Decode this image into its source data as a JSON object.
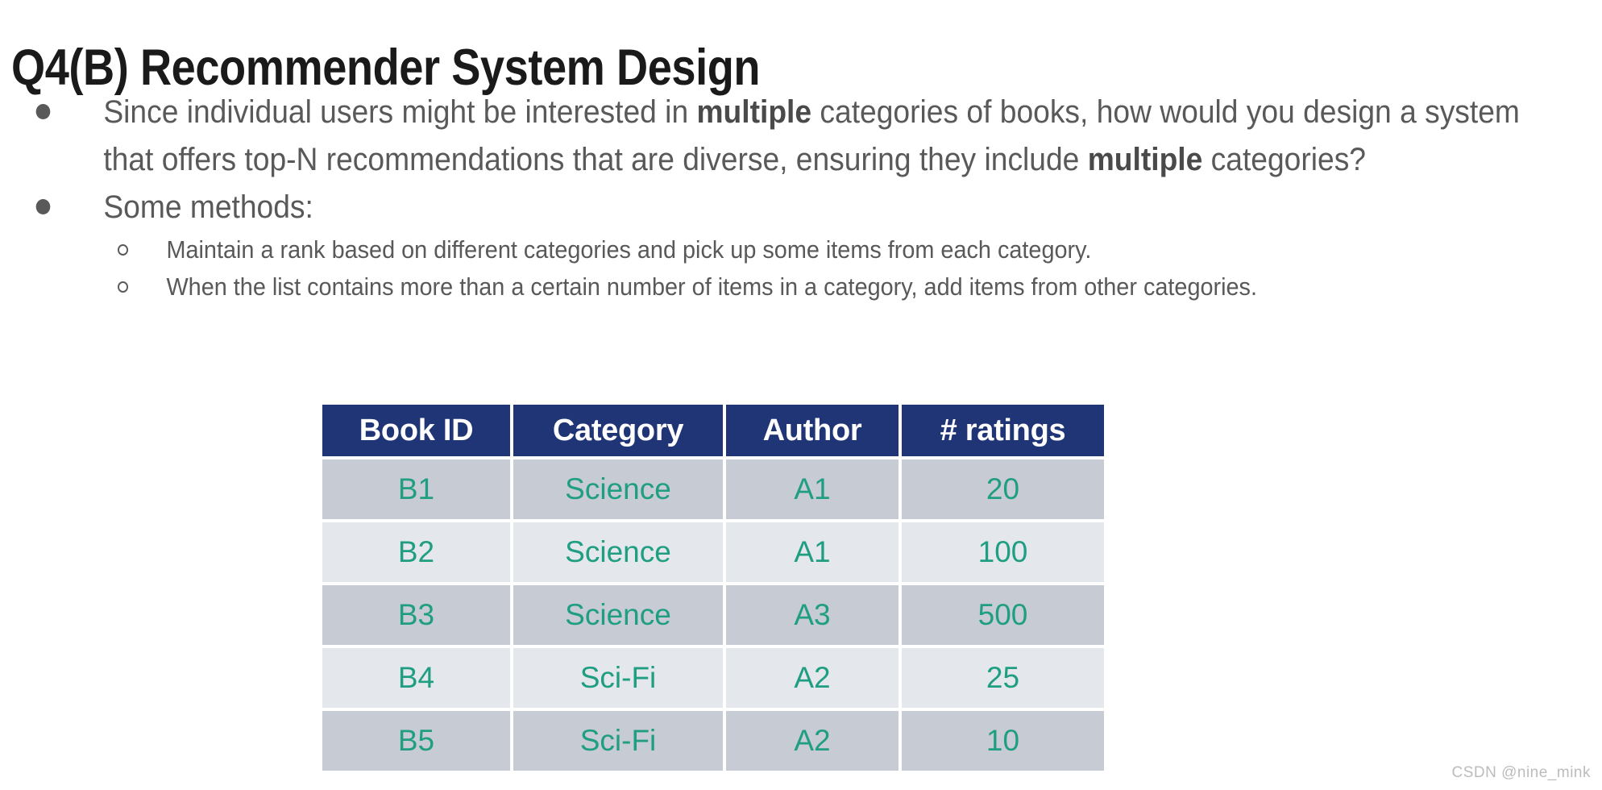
{
  "slide": {
    "title": "Q4(B) Recommender System Design",
    "bullets": [
      {
        "level": 1,
        "marker": "filled-disc",
        "segments": [
          {
            "text": "Since individual users might be interested in ",
            "bold": false
          },
          {
            "text": "multiple",
            "bold": true
          },
          {
            "text": " categories of books, how would you design a system that offers top-N recommendations that are diverse, ensuring they include ",
            "bold": false
          },
          {
            "text": "multiple",
            "bold": true
          },
          {
            "text": " categories?",
            "bold": false
          }
        ]
      },
      {
        "level": 1,
        "marker": "filled-disc",
        "segments": [
          {
            "text": "Some methods:",
            "bold": false
          }
        ]
      },
      {
        "level": 2,
        "marker": "hollow-circle",
        "segments": [
          {
            "text": "Maintain a rank based on different categories and pick up some items from each category.",
            "bold": false
          }
        ]
      },
      {
        "level": 2,
        "marker": "hollow-circle",
        "segments": [
          {
            "text": "When the list contains more than a certain number of items in a category, add items from other categories.",
            "bold": false
          }
        ]
      }
    ]
  },
  "table": {
    "headers": [
      "Book ID",
      "Category",
      "Author",
      "# ratings"
    ],
    "rows": [
      [
        "B1",
        "Science",
        "A1",
        "20"
      ],
      [
        "B2",
        "Science",
        "A1",
        "100"
      ],
      [
        "B3",
        "Science",
        "A3",
        "500"
      ],
      [
        "B4",
        "Sci-Fi",
        "A2",
        "25"
      ],
      [
        "B5",
        "Sci-Fi",
        "A2",
        "10"
      ]
    ]
  },
  "watermark": {
    "text": "CSDN @nine_mink"
  },
  "colors": {
    "title": "#1a1a1a",
    "body_text": "#595959",
    "table_header_bg": "#1f3576",
    "table_header_text": "#ffffff",
    "table_cell_text": "#1f9e82",
    "row_dark_bg": "#c7cbd4",
    "row_light_bg": "#e4e7ec",
    "watermark": "#bcbcbc"
  }
}
